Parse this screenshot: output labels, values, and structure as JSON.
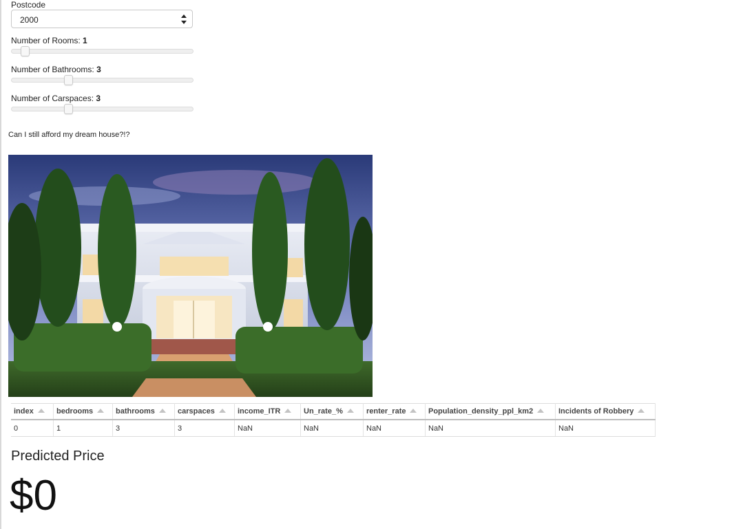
{
  "postcode": {
    "label": "Postcode",
    "value": "2000"
  },
  "sliders": [
    {
      "label": "Number of Rooms:",
      "value": "1",
      "level": 0.05
    },
    {
      "label": "Number of Bathrooms:",
      "value": "3",
      "level": 0.3
    },
    {
      "label": "Number of Carspaces:",
      "value": "3",
      "level": 0.3
    }
  ],
  "question": "Can I still afford my dream house?!?",
  "image": {
    "icon": "house-photo"
  },
  "table": {
    "columns": [
      "index",
      "bedrooms",
      "bathrooms",
      "carspaces",
      "income_ITR",
      "Un_rate_%",
      "renter_rate",
      "Population_density_ppl_km2",
      "Incidents of Robbery"
    ],
    "rows": [
      [
        "0",
        "1",
        "3",
        "3",
        "NaN",
        "NaN",
        "NaN",
        "NaN",
        "NaN"
      ]
    ]
  },
  "prediction": {
    "title": "Predicted Price",
    "value": "$0"
  },
  "colors": {
    "track": "#efefef",
    "thumb": "#f7f7f7",
    "sort_arrow": "#c3c3c3"
  }
}
